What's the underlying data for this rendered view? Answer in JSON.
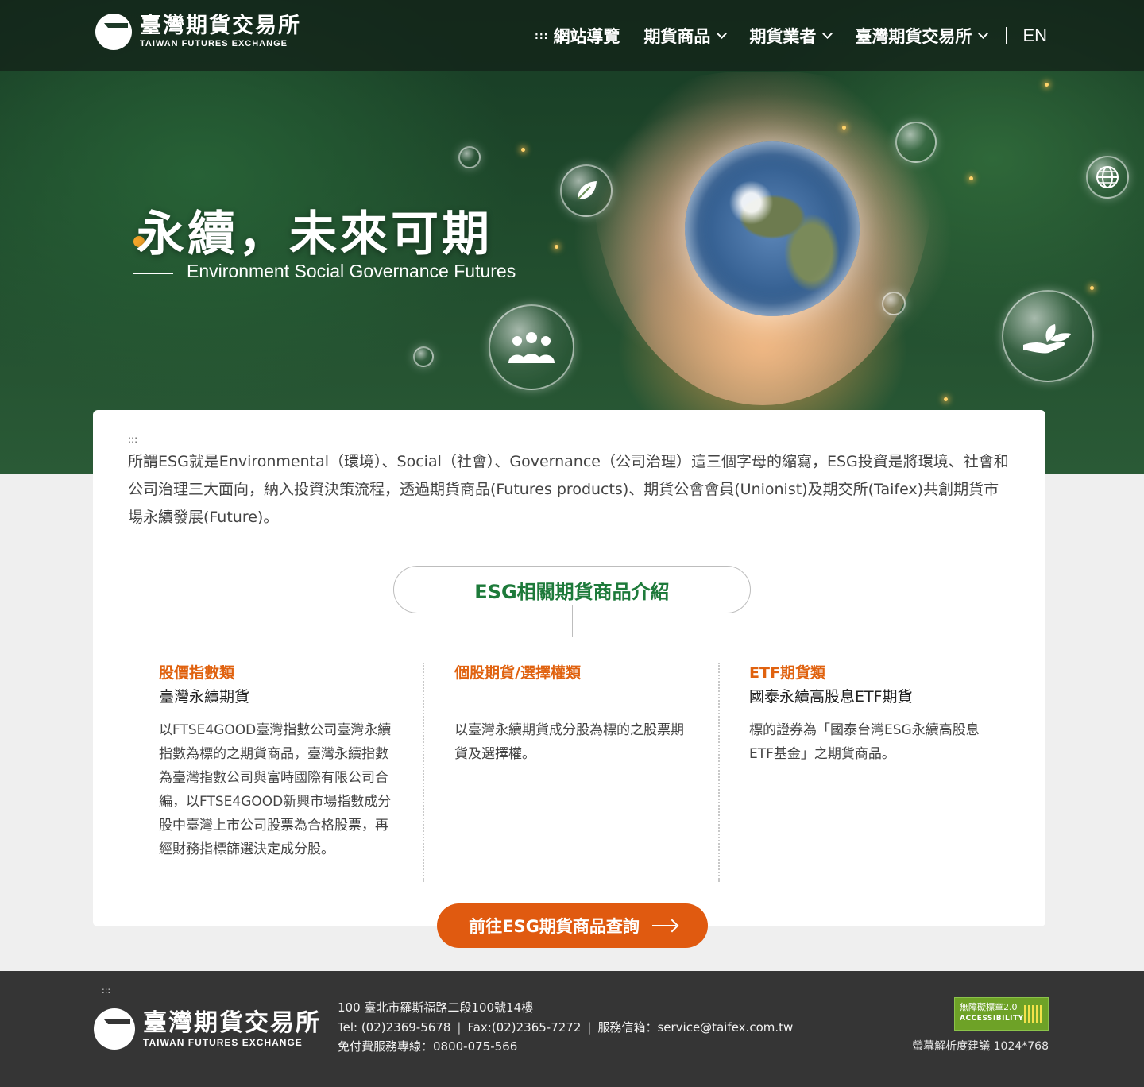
{
  "header": {
    "logo_cn": "臺灣期貨交易所",
    "logo_en": "TAIWAN FUTURES EXCHANGE",
    "access_key": ":::",
    "nav": [
      {
        "label": "網站導覽"
      },
      {
        "label": "期貨商品"
      },
      {
        "label": "期貨業者"
      },
      {
        "label": "臺灣期貨交易所"
      }
    ],
    "lang": "EN"
  },
  "hero": {
    "title": "永續，未來可期",
    "subtitle": "Environment Social Governance Futures"
  },
  "intro": {
    "access_key": ":::",
    "text": "所謂ESG就是Environmental（環境）、Social（社會）、Governance（公司治理）這三個字母的縮寫，ESG投資是將環境、社會和公司治理三大面向，納入投資決策流程，透過期貨商品(Futures products)、期貨公會會員(Unionist)及期交所(Taifex)共創期貨市場永續發展(Future)。"
  },
  "section": {
    "title": "ESG相關期貨商品介紹"
  },
  "products": [
    {
      "category": "股價指數類",
      "name": "臺灣永續期貨",
      "description": "以FTSE4GOOD臺灣指數公司臺灣永續指數為標的之期貨商品，臺灣永續指數為臺灣指數公司與富時國際有限公司合編，以FTSE4GOOD新興市場指數成分股中臺灣上市公司股票為合格股票，再經財務指標篩選決定成分股。"
    },
    {
      "category": "個股期貨/選擇權類",
      "name": "",
      "description": "以臺灣永續期貨成分股為標的之股票期貨及選擇權。"
    },
    {
      "category": "ETF期貨類",
      "name": "國泰永續高股息ETF期貨",
      "description": "標的證券為「國泰台灣ESG永續高股息ETF基金」之期貨商品。"
    }
  ],
  "cta": {
    "label": "前往ESG期貨商品查詢"
  },
  "footer": {
    "access_key": ":::",
    "logo_cn": "臺灣期貨交易所",
    "logo_en": "TAIWAN FUTURES EXCHANGE",
    "address": "100 臺北市羅斯福路二段100號14樓",
    "tel": "Tel: (02)2369-5678",
    "fax": "Fax:(02)2365-7272",
    "email": "服務信箱：service@taifex.com.tw",
    "hotline": "免付費服務專線：0800-075-566",
    "badge_title": "無障礙標章2.0",
    "badge_sub": "ACCESSIBILITY",
    "resolution": "螢幕解析度建議 1024*768"
  },
  "colors": {
    "accent_green": "#1d7a3a",
    "accent_orange": "#e05a10",
    "footer_bg": "#353535"
  },
  "icons": [
    "leaf-icon",
    "people-icon",
    "globe-icon",
    "hand-plant-icon",
    "chevron-down-icon",
    "arrow-right-icon"
  ]
}
